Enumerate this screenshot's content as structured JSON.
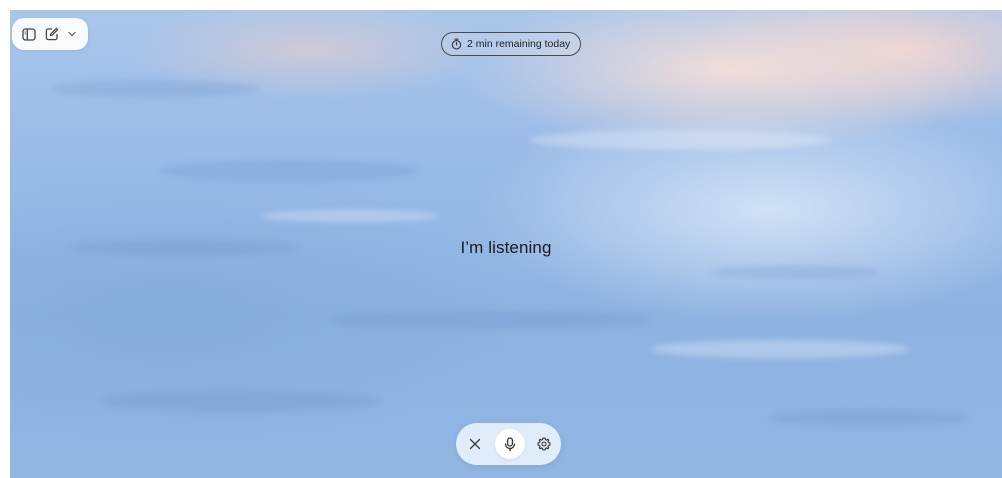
{
  "toolbar": {
    "sidebar_icon": "sidebar-toggle-icon",
    "new_chat_icon": "edit-icon",
    "dropdown_icon": "chevron-down-icon"
  },
  "timer": {
    "icon": "stopwatch-icon",
    "label": "2 min remaining today"
  },
  "status": {
    "text": "I’m listening"
  },
  "controls": {
    "close_icon": "close-icon",
    "mic_icon": "microphone-icon",
    "settings_icon": "gear-icon"
  },
  "colors": {
    "background_top": "#a9c6ea",
    "background_bottom": "#92b6e2",
    "text": "#1c1c1c",
    "control_bar": "#e8f1fc"
  }
}
